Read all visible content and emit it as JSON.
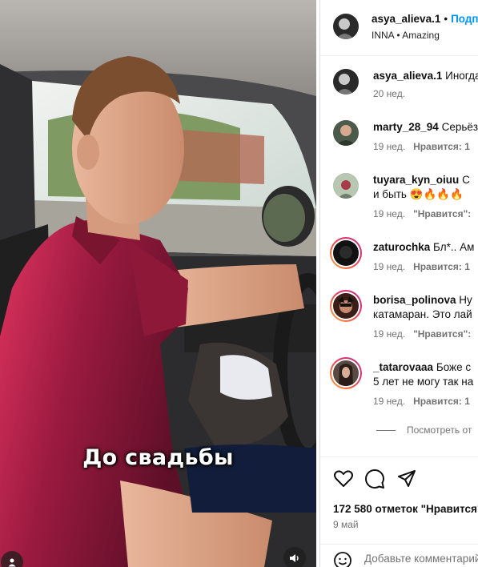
{
  "video": {
    "subtitle": "До свадьбы"
  },
  "header": {
    "username": "asya_alieva.1",
    "separator": "•",
    "follow_label": "Подписаться",
    "audio": "INNA • Amazing"
  },
  "comments": [
    {
      "username": "asya_alieva.1",
      "text": "Иногда",
      "line2": "",
      "age": "20 нед.",
      "likes": ""
    },
    {
      "username": "marty_28_94",
      "text": "Серьёзно",
      "line2": "",
      "age": "19 нед.",
      "likes": "Нравится: 1"
    },
    {
      "username": "tuyara_kyn_oiuu",
      "text": "С",
      "line2": "и быть 😍🔥🔥🔥",
      "age": "19 нед.",
      "likes": "\"Нравится\":"
    },
    {
      "username": "zaturochka",
      "text": "Бл*.. Ам",
      "line2": "",
      "age": "19 нед.",
      "likes": "Нравится: 1"
    },
    {
      "username": "borisa_polinova",
      "text": "Ну",
      "line2": "катамаран. Это лай",
      "age": "19 нед.",
      "likes": "\"Нравится\":"
    },
    {
      "username": "_tatarovaaa",
      "text": "Боже с",
      "line2": "5 лет не могу так на",
      "age": "19 нед.",
      "likes": "Нравится: 1"
    }
  ],
  "more_replies": "Посмотреть от",
  "actions": {
    "likes_count": "172 580 отметок \"Нравится\"",
    "date": "9 май"
  },
  "add_comment": {
    "placeholder": "Добавьте комментарий..."
  },
  "icons": {
    "like": "heart-icon",
    "comment": "comment-icon",
    "share": "share-icon",
    "emoji": "emoji-icon",
    "sound": "speaker-icon",
    "tags": "user-icon"
  },
  "colors": {
    "accent": "#0095f6",
    "meta": "#737373",
    "shirt": "#8a1a3a"
  }
}
